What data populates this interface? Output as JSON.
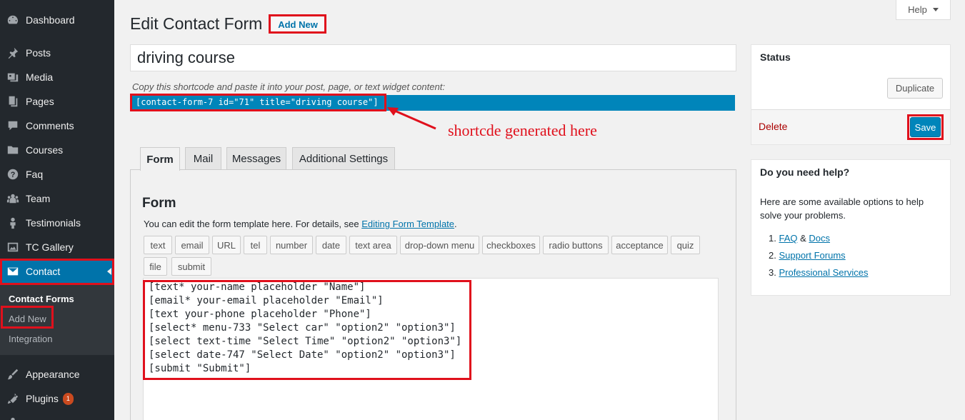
{
  "sidebar": {
    "items": [
      {
        "label": "Dashboard",
        "icon": "dashboard-icon"
      },
      {
        "label": "Posts",
        "icon": "pin-icon"
      },
      {
        "label": "Media",
        "icon": "media-icon"
      },
      {
        "label": "Pages",
        "icon": "pages-icon"
      },
      {
        "label": "Comments",
        "icon": "comment-icon"
      },
      {
        "label": "Courses",
        "icon": "folder-icon"
      },
      {
        "label": "Faq",
        "icon": "question-icon"
      },
      {
        "label": "Team",
        "icon": "groups-icon"
      },
      {
        "label": "Testimonials",
        "icon": "person-icon"
      },
      {
        "label": "TC Gallery",
        "icon": "gallery-icon"
      },
      {
        "label": "Contact",
        "icon": "mail-icon"
      },
      {
        "label": "Appearance",
        "icon": "brush-icon"
      },
      {
        "label": "Plugins",
        "icon": "plugin-icon",
        "badge": "1"
      }
    ],
    "submenu": [
      "Contact Forms",
      "Add New",
      "Integration"
    ]
  },
  "header": {
    "title": "Edit Contact Form",
    "add_new": "Add New",
    "help": "Help"
  },
  "form_title": "driving course",
  "shortcode": {
    "hint": "Copy this shortcode and paste it into your post, page, or text widget content:",
    "code": "[contact-form-7 id=\"71\" title=\"driving course\"]"
  },
  "annotation": "shortcde generated here",
  "tabs": [
    "Form",
    "Mail",
    "Messages",
    "Additional Settings"
  ],
  "panel": {
    "title": "Form",
    "desc_prefix": "You can edit the form template here. For details, see ",
    "desc_link": "Editing Form Template",
    "desc_suffix": "."
  },
  "tag_buttons": [
    "text",
    "email",
    "URL",
    "tel",
    "number",
    "date",
    "text area",
    "drop-down menu",
    "checkboxes",
    "radio buttons",
    "acceptance",
    "quiz",
    "file",
    "submit"
  ],
  "form_code": "[text* your-name placeholder \"Name\"]\n[email* your-email placeholder \"Email\"]\n[text your-phone placeholder \"Phone\"]\n[select* menu-733 \"Select car\" \"option2\" \"option3\"]\n[select text-time \"Select Time\" \"option2\" \"option3\"]\n[select date-747 \"Select Date\" \"option2\" \"option3\"]\n[submit \"Submit\"]",
  "status_box": {
    "title": "Status",
    "duplicate": "Duplicate",
    "delete": "Delete",
    "save": "Save"
  },
  "help_box": {
    "title": "Do you need help?",
    "text": "Here are some available options to help solve your problems.",
    "items": [
      {
        "num": "1.",
        "link1": "FAQ",
        "sep": " & ",
        "link2": "Docs"
      },
      {
        "num": "2.",
        "link1": "Support Forums"
      },
      {
        "num": "3.",
        "link1": "Professional Services"
      }
    ]
  },
  "colors": {
    "sidebar_bg": "#23282d",
    "accent": "#0073aa",
    "annotation_red": "#e0101c"
  }
}
